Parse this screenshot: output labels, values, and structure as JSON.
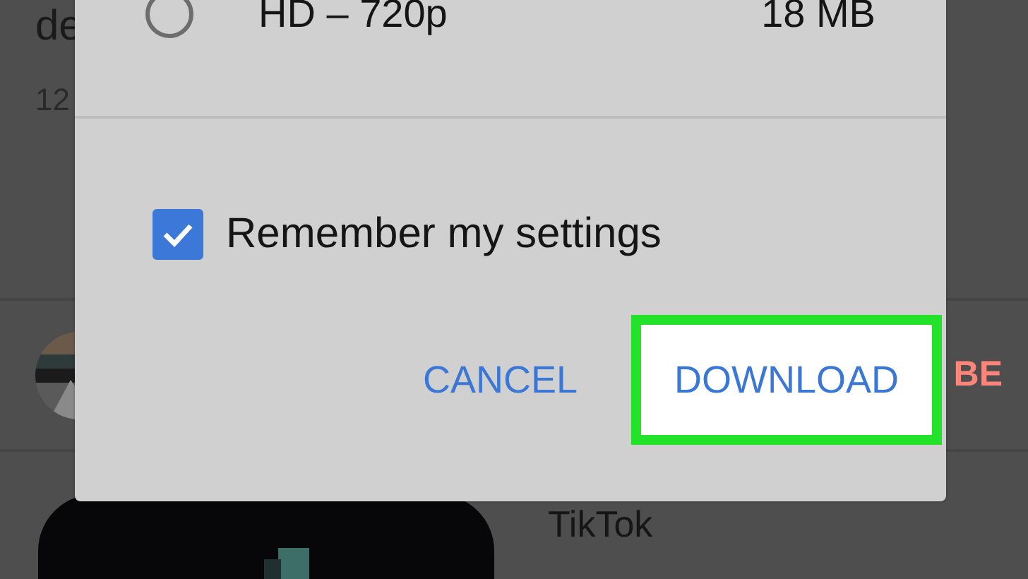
{
  "background": {
    "video_title": "de",
    "video_meta": "12",
    "channel_action": "BE",
    "next_video_title": "TikTok"
  },
  "dialog": {
    "options": [
      {
        "label": "HD – 720p",
        "size": "18 MB",
        "selected": false
      }
    ],
    "remember": {
      "label": "Remember my settings",
      "checked": true
    },
    "buttons": [
      {
        "label": "CANCEL",
        "kind": "plain"
      },
      {
        "label": "DOWNLOAD",
        "kind": "highlighted"
      }
    ]
  }
}
